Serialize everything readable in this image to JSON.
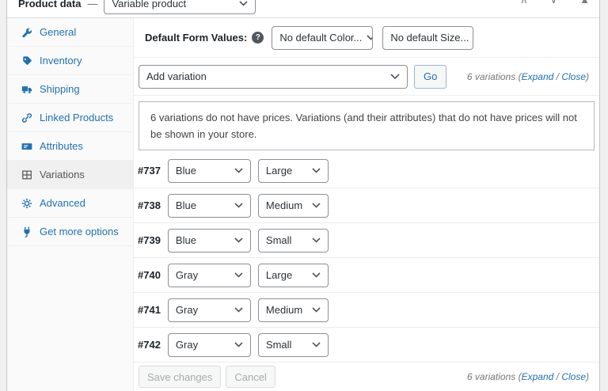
{
  "colors": {
    "accent": "#2271b1",
    "active_tab_text": "#555555",
    "page_bg": "#f0f0f1"
  },
  "header": {
    "title": "Product data",
    "dash": "—",
    "product_type_value": "Variable product",
    "move_up_glyph": "∧",
    "move_down_glyph": "∨",
    "toggle_glyph": "▲"
  },
  "sidebar": {
    "items": [
      {
        "label": "General",
        "icon": "wrench-icon",
        "active": false
      },
      {
        "label": "Inventory",
        "icon": "tag-icon",
        "active": false
      },
      {
        "label": "Shipping",
        "icon": "truck-icon",
        "active": false
      },
      {
        "label": "Linked Products",
        "icon": "link-icon",
        "active": false
      },
      {
        "label": "Attributes",
        "icon": "card-icon",
        "active": false
      },
      {
        "label": "Variations",
        "icon": "grid-icon",
        "active": true
      },
      {
        "label": "Advanced",
        "icon": "gear-icon",
        "active": false
      },
      {
        "label": "Get more options",
        "icon": "plug-icon",
        "active": false
      }
    ]
  },
  "defaults_row": {
    "label": "Default Form Values:",
    "help_glyph": "?",
    "color_select_value": "No default Color...",
    "size_select_value": "No default Size..."
  },
  "toolbar_top": {
    "add_select_value": "Add variation",
    "go_label": "Go",
    "count_prefix": "6 variations (",
    "expand_label": "Expand",
    "separator": " / ",
    "close_label": "Close",
    "count_suffix": ")"
  },
  "notice": {
    "text": "6 variations do not have prices. Variations (and their attributes) that do not have prices will not be shown in your store."
  },
  "variations": {
    "rows": [
      {
        "id": "#737",
        "color": "Blue",
        "size": "Large"
      },
      {
        "id": "#738",
        "color": "Blue",
        "size": "Medium"
      },
      {
        "id": "#739",
        "color": "Blue",
        "size": "Small"
      },
      {
        "id": "#740",
        "color": "Gray",
        "size": "Large"
      },
      {
        "id": "#741",
        "color": "Gray",
        "size": "Medium"
      },
      {
        "id": "#742",
        "color": "Gray",
        "size": "Small"
      }
    ]
  },
  "toolbar_bottom": {
    "save_label": "Save changes",
    "cancel_label": "Cancel",
    "count_prefix": "6 variations (",
    "expand_label": "Expand",
    "separator": " / ",
    "close_label": "Close",
    "count_suffix": ")"
  }
}
